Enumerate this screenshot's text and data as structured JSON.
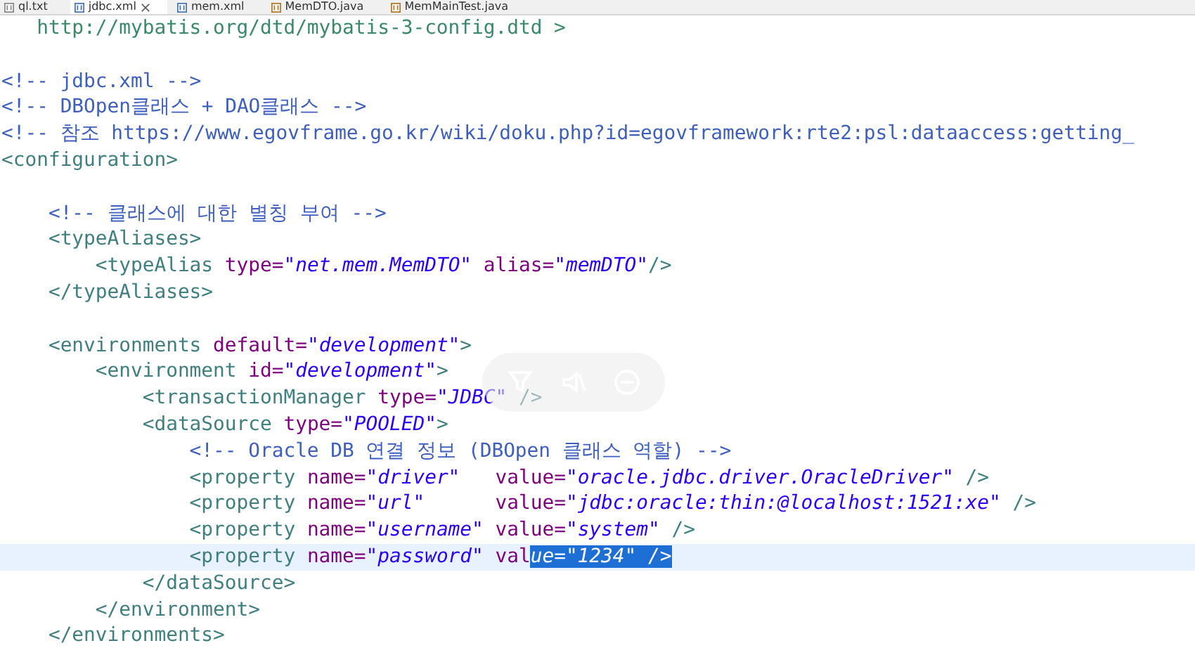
{
  "tabs": [
    {
      "label": "ql.txt",
      "kind": "text",
      "selected": false,
      "closable": false
    },
    {
      "label": "jdbc.xml",
      "kind": "xml",
      "selected": true,
      "closable": true
    },
    {
      "label": "mem.xml",
      "kind": "xml",
      "selected": false,
      "closable": false
    },
    {
      "label": "MemDTO.java",
      "kind": "java",
      "selected": false,
      "closable": false
    },
    {
      "label": "MemMainTest.java",
      "kind": "java",
      "selected": false,
      "closable": false
    }
  ],
  "lines": [
    {
      "current": false,
      "tokens": [
        {
          "kind": "doctype",
          "text": "   http://mybatis.org/dtd/mybatis-3-config.dtd >"
        }
      ]
    },
    {
      "current": false
    },
    {
      "current": false,
      "tokens": [
        {
          "kind": "comment",
          "text": "<!-- jdbc.xml -->"
        }
      ]
    },
    {
      "current": false,
      "tokens": [
        {
          "kind": "comment",
          "text": "<!-- DBOpen클래스 + DAO클래스 -->"
        }
      ]
    },
    {
      "current": false,
      "tokens": [
        {
          "kind": "comment",
          "text": "<!-- 참조 https://www.egovframe.go.kr/wiki/doku.php?id=egovframework:rte2:psl:dataaccess:getting_"
        }
      ]
    },
    {
      "current": false,
      "tokens": [
        {
          "kind": "tag",
          "text": "<configuration>"
        }
      ]
    },
    {
      "current": false
    },
    {
      "current": false,
      "tokens": [
        {
          "kind": "comment",
          "text": "    <!-- 클래스에 대한 별칭 부여 -->"
        }
      ]
    },
    {
      "current": false,
      "tokens": [
        {
          "kind": "tag",
          "text": "    <typeAliases>"
        }
      ]
    },
    {
      "current": false,
      "tokens": [
        {
          "kind": "tag",
          "text": "        <typeAlias"
        },
        {
          "kind": "attr",
          "text": " type="
        },
        {
          "kind": "value",
          "text": "\"net.mem.MemDTO\""
        },
        {
          "kind": "attr",
          "text": " alias="
        },
        {
          "kind": "value",
          "text": "\"memDTO\""
        },
        {
          "kind": "tag",
          "text": "/>"
        }
      ]
    },
    {
      "current": false,
      "tokens": [
        {
          "kind": "tag",
          "text": "    </typeAliases>"
        }
      ]
    },
    {
      "current": false
    },
    {
      "current": false,
      "tokens": [
        {
          "kind": "tag",
          "text": "    <environments"
        },
        {
          "kind": "attr",
          "text": " default="
        },
        {
          "kind": "value",
          "text": "\"development\""
        },
        {
          "kind": "tag",
          "text": ">"
        }
      ]
    },
    {
      "current": false,
      "tokens": [
        {
          "kind": "tag",
          "text": "        <environment"
        },
        {
          "kind": "attr",
          "text": " id="
        },
        {
          "kind": "value",
          "text": "\"development\""
        },
        {
          "kind": "tag",
          "text": ">"
        }
      ]
    },
    {
      "current": false,
      "tokens": [
        {
          "kind": "tag",
          "text": "            <transactionManager"
        },
        {
          "kind": "attr",
          "text": " type="
        },
        {
          "kind": "value",
          "text": "\"JDBC\""
        },
        {
          "kind": "tag",
          "text": " />"
        }
      ]
    },
    {
      "current": false,
      "tokens": [
        {
          "kind": "tag",
          "text": "            <dataSource"
        },
        {
          "kind": "attr",
          "text": " type="
        },
        {
          "kind": "value",
          "text": "\"POOLED\""
        },
        {
          "kind": "tag",
          "text": ">"
        }
      ]
    },
    {
      "current": false,
      "tokens": [
        {
          "kind": "comment",
          "text": "                <!-- Oracle DB 연결 정보 (DBOpen 클래스 역할) -->"
        }
      ]
    },
    {
      "current": false,
      "tokens": [
        {
          "kind": "tag",
          "text": "                <property"
        },
        {
          "kind": "attr",
          "text": " name="
        },
        {
          "kind": "value",
          "text": "\"driver\""
        },
        {
          "kind": "attr",
          "text": "   value="
        },
        {
          "kind": "value",
          "text": "\"oracle.jdbc.driver.OracleDriver\""
        },
        {
          "kind": "tag",
          "text": " />"
        }
      ]
    },
    {
      "current": false,
      "tokens": [
        {
          "kind": "tag",
          "text": "                <property"
        },
        {
          "kind": "attr",
          "text": " name="
        },
        {
          "kind": "value",
          "text": "\"url\""
        },
        {
          "kind": "attr",
          "text": "      value="
        },
        {
          "kind": "value",
          "text": "\"jdbc:oracle:thin:@localhost:1521:xe\""
        },
        {
          "kind": "tag",
          "text": " />"
        }
      ]
    },
    {
      "current": false,
      "tokens": [
        {
          "kind": "tag",
          "text": "                <property"
        },
        {
          "kind": "attr",
          "text": " name="
        },
        {
          "kind": "value",
          "text": "\"username\""
        },
        {
          "kind": "attr",
          "text": " value="
        },
        {
          "kind": "value",
          "text": "\"system\""
        },
        {
          "kind": "tag",
          "text": " />"
        }
      ]
    },
    {
      "current": true,
      "tokens": [
        {
          "kind": "tag",
          "text": "                <property"
        },
        {
          "kind": "attr",
          "text": " name="
        },
        {
          "kind": "value",
          "text": "\"password\""
        },
        {
          "kind": "attr",
          "text": " val"
        },
        {
          "kind": "selection",
          "text": "ue=\"1234\" />"
        }
      ]
    },
    {
      "current": false,
      "tokens": [
        {
          "kind": "tag",
          "text": "            </dataSource>"
        }
      ]
    },
    {
      "current": false,
      "tokens": [
        {
          "kind": "tag",
          "text": "        </environment>"
        }
      ]
    },
    {
      "current": false,
      "tokens": [
        {
          "kind": "tag",
          "text": "    </environments>"
        }
      ]
    }
  ]
}
